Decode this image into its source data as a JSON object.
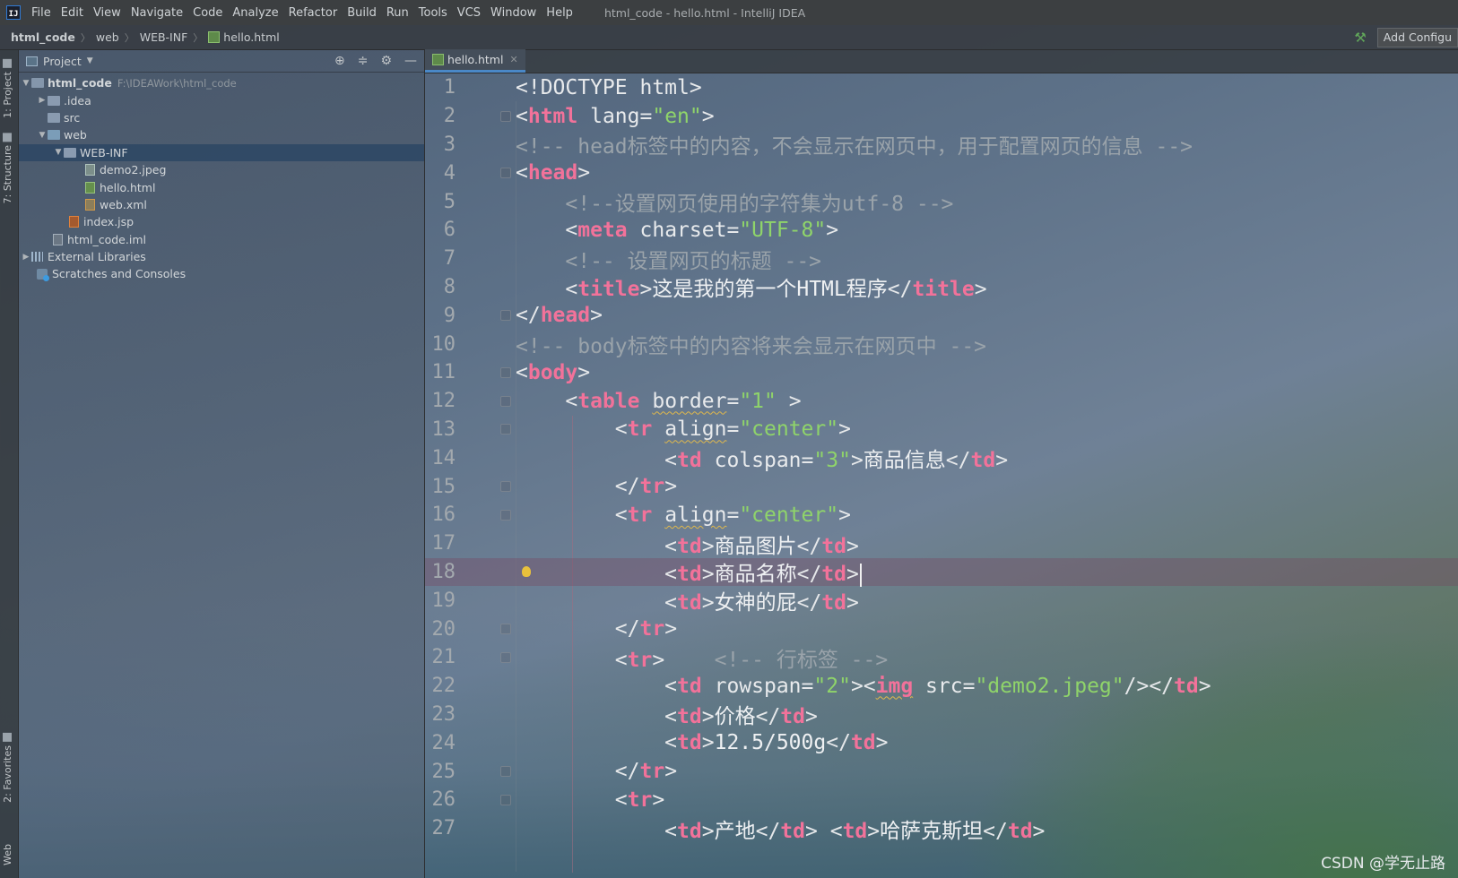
{
  "menubar": {
    "items": [
      "File",
      "Edit",
      "View",
      "Navigate",
      "Code",
      "Analyze",
      "Refactor",
      "Build",
      "Run",
      "Tools",
      "VCS",
      "Window",
      "Help"
    ],
    "window_title": "html_code - hello.html - IntelliJ IDEA"
  },
  "navbar": {
    "crumbs": [
      "html_code",
      "web",
      "WEB-INF",
      "hello.html"
    ],
    "add_config": "Add Configu"
  },
  "toolstrip": {
    "project_tab": "1: Project",
    "structure_tab": "7: Structure",
    "favorites_tab": "2: Favorites",
    "web_tab": "Web"
  },
  "project_panel": {
    "title": "Project",
    "root": {
      "name": "html_code",
      "path": "F:\\IDEAWork\\html_code"
    },
    "items": [
      ".idea",
      "src",
      "web",
      "WEB-INF",
      "demo2.jpeg",
      "hello.html",
      "web.xml",
      "index.jsp",
      "html_code.iml",
      "External Libraries",
      "Scratches and Consoles"
    ]
  },
  "editor": {
    "tab_name": "hello.html",
    "line_numbers": [
      "1",
      "2",
      "3",
      "4",
      "5",
      "6",
      "7",
      "8",
      "9",
      "10",
      "11",
      "12",
      "13",
      "14",
      "15",
      "16",
      "17",
      "18",
      "19",
      "20",
      "21",
      "22",
      "23",
      "24",
      "25",
      "26",
      "27"
    ],
    "current_line": 18,
    "code": {
      "l1": "<!DOCTYPE html>",
      "l2_lang": "\"en\"",
      "l3": "<!-- head标签中的内容，不会显示在网页中，用于配置网页的信息 -->",
      "l5": "<!--设置网页使用的字符集为utf-8 -->",
      "l6_charset": "\"UTF-8\"",
      "l7": "<!-- 设置网页的标题 -->",
      "l8_title": "这是我的第一个HTML程序",
      "l10": "<!-- body标签中的内容将来会显示在网页中 -->",
      "l12_border": "\"1\"",
      "l13_align": "\"center\"",
      "l14_colspan": "\"3\"",
      "l14_text": "商品信息",
      "l16_align": "\"center\"",
      "l17_text": "商品图片",
      "l18_text": "商品名称",
      "l19_text": "女神的屁",
      "l21_comment": "<!-- 行标签 -->",
      "l22_rowspan": "\"2\"",
      "l22_src": "\"demo2.jpeg\"",
      "l23_text": "价格",
      "l24_text": "12.5/500g",
      "l27_text1": "产地",
      "l27_text2": "哈萨克斯坦"
    }
  },
  "watermark": "CSDN @学无止路"
}
